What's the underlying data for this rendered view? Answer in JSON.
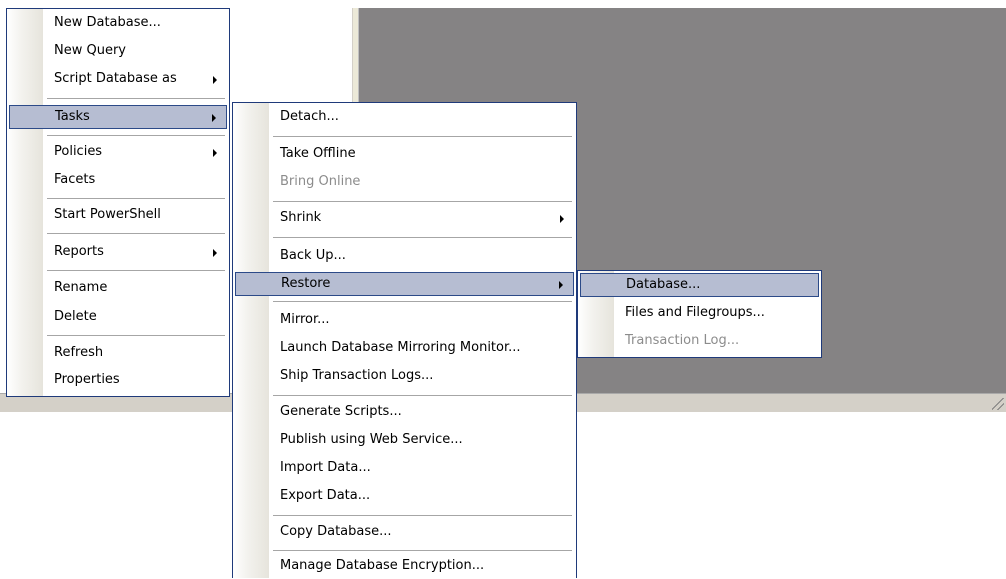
{
  "main_menu": {
    "items": [
      {
        "label": "New Database..."
      },
      {
        "label": "New Query"
      },
      {
        "label": "Script Database as"
      },
      {
        "label": "Tasks"
      },
      {
        "label": "Policies"
      },
      {
        "label": "Facets"
      },
      {
        "label": "Start PowerShell"
      },
      {
        "label": "Reports"
      },
      {
        "label": "Rename"
      },
      {
        "label": "Delete"
      },
      {
        "label": "Refresh"
      },
      {
        "label": "Properties"
      }
    ]
  },
  "tasks_menu": {
    "items": [
      {
        "label": "Detach..."
      },
      {
        "label": "Take Offline"
      },
      {
        "label": "Bring Online"
      },
      {
        "label": "Shrink"
      },
      {
        "label": "Back Up..."
      },
      {
        "label": "Restore"
      },
      {
        "label": "Mirror..."
      },
      {
        "label": "Launch Database Mirroring Monitor..."
      },
      {
        "label": "Ship Transaction Logs..."
      },
      {
        "label": "Generate Scripts..."
      },
      {
        "label": "Publish using Web Service..."
      },
      {
        "label": "Import Data..."
      },
      {
        "label": "Export Data..."
      },
      {
        "label": "Copy Database..."
      },
      {
        "label": "Manage Database Encryption..."
      }
    ]
  },
  "restore_menu": {
    "items": [
      {
        "label": "Database..."
      },
      {
        "label": "Files and Filegroups..."
      },
      {
        "label": "Transaction Log..."
      }
    ]
  },
  "colors": {
    "menu_border": "#1f3a7a",
    "highlight": "#b6bdd2",
    "disabled_text": "#8c8c8c",
    "canvas": "#858384"
  },
  "icons": {
    "submenu": "submenu-arrow-icon",
    "grip": "resize-grip-icon"
  }
}
